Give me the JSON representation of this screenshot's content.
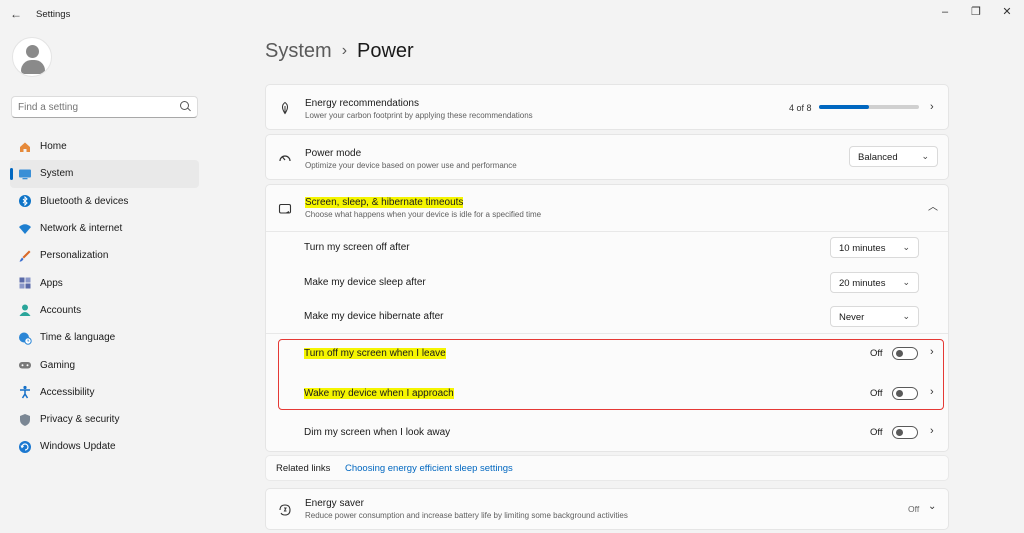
{
  "window": {
    "title": "Settings"
  },
  "search": {
    "placeholder": "Find a setting"
  },
  "nav": {
    "items": [
      {
        "label": "Home",
        "icon": "home-icon",
        "color": "#e68a3a"
      },
      {
        "label": "System",
        "icon": "monitor-icon",
        "color": "#3a8fd6",
        "active": true
      },
      {
        "label": "Bluetooth & devices",
        "icon": "bluetooth-icon",
        "color": "#0e74c8"
      },
      {
        "label": "Network & internet",
        "icon": "wifi-icon",
        "color": "#1e7fd0"
      },
      {
        "label": "Personalization",
        "icon": "paintbrush-icon",
        "color": "#d96a2a"
      },
      {
        "label": "Apps",
        "icon": "apps-icon",
        "color": "#5a6aa8"
      },
      {
        "label": "Accounts",
        "icon": "person-icon",
        "color": "#2aa59a"
      },
      {
        "label": "Time & language",
        "icon": "globe-clock-icon",
        "color": "#2b86d6"
      },
      {
        "label": "Gaming",
        "icon": "gamepad-icon",
        "color": "#7a7a7a"
      },
      {
        "label": "Accessibility",
        "icon": "accessibility-icon",
        "color": "#1570c8"
      },
      {
        "label": "Privacy & security",
        "icon": "shield-icon",
        "color": "#7b8794"
      },
      {
        "label": "Windows Update",
        "icon": "update-icon",
        "color": "#1b78d0"
      }
    ]
  },
  "breadcrumb": {
    "parent": "System",
    "separator": "›",
    "current": "Power"
  },
  "energy": {
    "title": "Energy recommendations",
    "desc": "Lower your carbon footprint by applying these recommendations",
    "count": "4 of 8",
    "progress": 0.5
  },
  "power_mode": {
    "title": "Power mode",
    "desc": "Optimize your device based on power use and performance",
    "value": "Balanced"
  },
  "timeouts": {
    "title": "Screen, sleep, & hibernate timeouts",
    "desc": "Choose what happens when your device is idle for a specified time",
    "rows": [
      {
        "label": "Turn my screen off after",
        "value": "10 minutes"
      },
      {
        "label": "Make my device sleep after",
        "value": "20 minutes"
      },
      {
        "label": "Make my device hibernate after",
        "value": "Never"
      }
    ]
  },
  "presence": [
    {
      "label": "Turn off my screen when I leave",
      "state": "Off"
    },
    {
      "label": "Wake my device when I approach",
      "state": "Off"
    },
    {
      "label": "Dim my screen when I look away",
      "state": "Off"
    }
  ],
  "related": {
    "label": "Related links",
    "link": "Choosing energy efficient sleep settings"
  },
  "energy_saver": {
    "title": "Energy saver",
    "desc": "Reduce power consumption and increase battery life by limiting some background activities",
    "state": "Off"
  },
  "colors": {
    "accent": "#0067c0",
    "highlight": "#f5f500",
    "annotation": "#e53935"
  }
}
